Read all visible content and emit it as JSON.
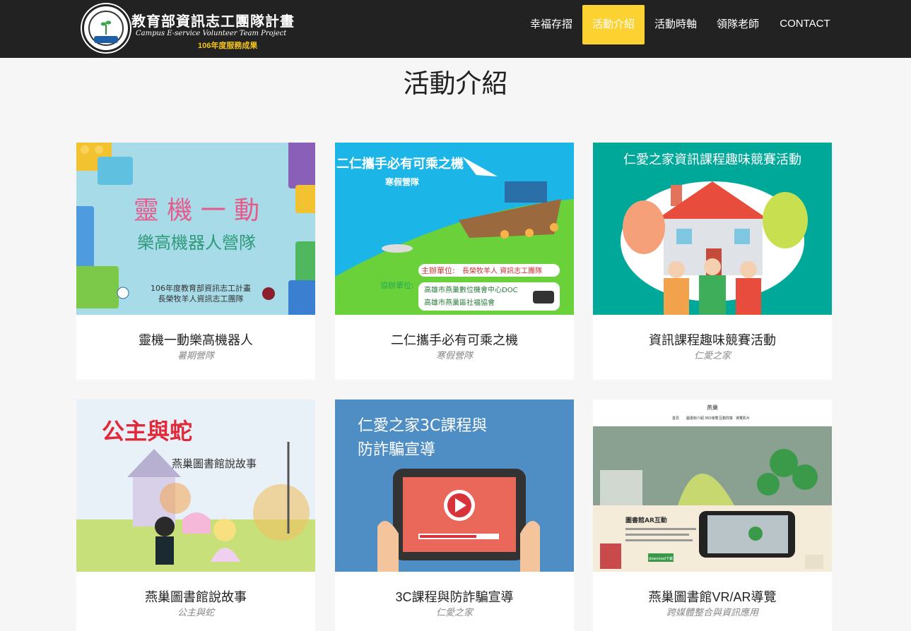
{
  "header": {
    "logo": {
      "seal_text": "MINISTRY OF EDUCATION",
      "seal_bottom": "教育部",
      "title": "教育部資訊志工團隊計畫",
      "subtitle": "Campus E-service Volunteer Team Project",
      "year_tag": "106年度服務成果"
    },
    "nav": [
      {
        "label": "幸福存摺",
        "active": false
      },
      {
        "label": "活動介紹",
        "active": true
      },
      {
        "label": "活動時軸",
        "active": false
      },
      {
        "label": "領隊老師",
        "active": false
      },
      {
        "label": "CONTACT",
        "active": false
      }
    ],
    "active_color": "#fcd232"
  },
  "section": {
    "title": "活動介紹"
  },
  "cards": [
    {
      "title": "靈機一動樂高機器人",
      "subtitle": "暑期營隊",
      "image": {
        "line1": "靈 機 一 動",
        "line2": "樂高機器人營隊",
        "footer1": "106年度教育部資訊志工計畫",
        "footer2": "長榮牧羊人資訊志工團隊"
      }
    },
    {
      "title": "二仁攜手必有可乘之機",
      "subtitle": "寒假營隊",
      "image": {
        "heading": "二仁攜手必有可乘之機",
        "sub": "寒假營隊",
        "org1_label": "主辦單位:",
        "org1": "長榮牧羊人 資訊志工團隊",
        "org2_label": "協辦單位:",
        "org2a": "高雄市燕巢數位機會中心DOC",
        "org2b": "高雄市燕巢區社福協會"
      }
    },
    {
      "title": "資訊課程趣味競賽活動",
      "subtitle": "仁愛之家",
      "image": {
        "heading": "仁愛之家資訊課程趣味競賽活動"
      }
    },
    {
      "title": "燕巢圖書館說故事",
      "subtitle": "公主與蛇",
      "image": {
        "heading": "公主與蛇",
        "sub": "燕巢圖書館說故事"
      }
    },
    {
      "title": "3C課程與防詐騙宣導",
      "subtitle": "仁愛之家",
      "image": {
        "line1": "仁愛之家3C課程與",
        "line2": "防詐騙宣導"
      }
    },
    {
      "title": "燕巢圖書館VR/AR導覽",
      "subtitle": "跨媒體整合與資訊應用",
      "image": {
        "site_name": "燕巢",
        "menu": [
          "首頁",
          "圖書館介紹",
          "360導覽",
          "互動問答",
          "導覽影片"
        ],
        "ar_title": "圖書館AR互動",
        "button": "download下載"
      }
    }
  ]
}
